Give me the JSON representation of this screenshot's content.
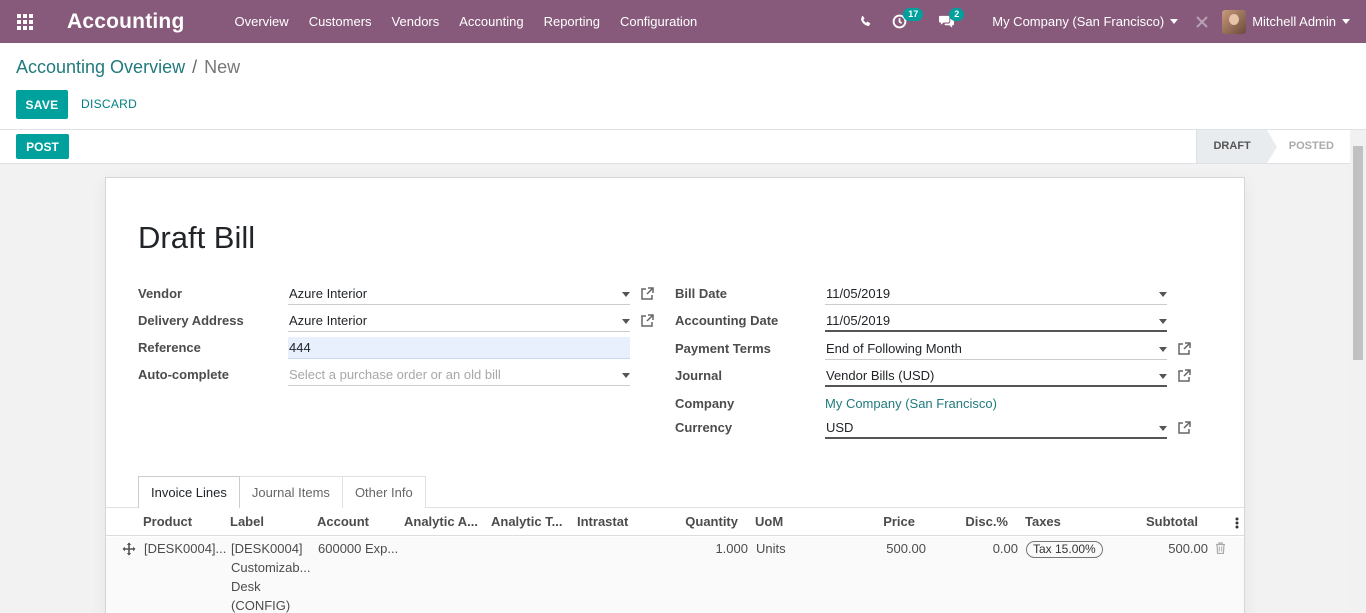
{
  "nav": {
    "brand": "Accounting",
    "menu": [
      "Overview",
      "Customers",
      "Vendors",
      "Accounting",
      "Reporting",
      "Configuration"
    ],
    "activities_count": "17",
    "messages_count": "2",
    "company": "My Company (San Francisco)",
    "user": "Mitchell Admin"
  },
  "breadcrumb": {
    "parent": "Accounting Overview",
    "separator": "/",
    "current": "New"
  },
  "buttons": {
    "save": "SAVE",
    "discard": "DISCARD",
    "post": "POST"
  },
  "stages": {
    "draft": "DRAFT",
    "posted": "POSTED"
  },
  "form": {
    "title": "Draft Bill",
    "left": {
      "vendor_label": "Vendor",
      "vendor": "Azure Interior",
      "delivery_label": "Delivery Address",
      "delivery": "Azure Interior",
      "reference_label": "Reference",
      "reference": "444",
      "autocomplete_label": "Auto-complete",
      "autocomplete_placeholder": "Select a purchase order or an old bill"
    },
    "right": {
      "bill_date_label": "Bill Date",
      "bill_date": "11/05/2019",
      "accounting_date_label": "Accounting Date",
      "accounting_date": "11/05/2019",
      "payment_terms_label": "Payment Terms",
      "payment_terms": "End of Following Month",
      "journal_label": "Journal",
      "journal": "Vendor Bills (USD)",
      "company_label": "Company",
      "company": "My Company (San Francisco)",
      "currency_label": "Currency",
      "currency": "USD"
    }
  },
  "tabs": [
    "Invoice Lines",
    "Journal Items",
    "Other Info"
  ],
  "table": {
    "headers": {
      "product": "Product",
      "label": "Label",
      "account": "Account",
      "analytic_account": "Analytic A...",
      "analytic_tags": "Analytic T...",
      "intrastat": "Intrastat",
      "quantity": "Quantity",
      "uom": "UoM",
      "price": "Price",
      "discount": "Disc.%",
      "taxes": "Taxes",
      "subtotal": "Subtotal"
    },
    "row": {
      "product": "[DESK0004]...",
      "label_lines": [
        "[DESK0004]",
        "Customizab...",
        "Desk",
        "(CONFIG)"
      ],
      "account": "600000 Exp...",
      "quantity": "1.000",
      "uom": "Units",
      "price": "500.00",
      "discount": "0.00",
      "tax": "Tax 15.00%",
      "subtotal": "500.00"
    }
  }
}
